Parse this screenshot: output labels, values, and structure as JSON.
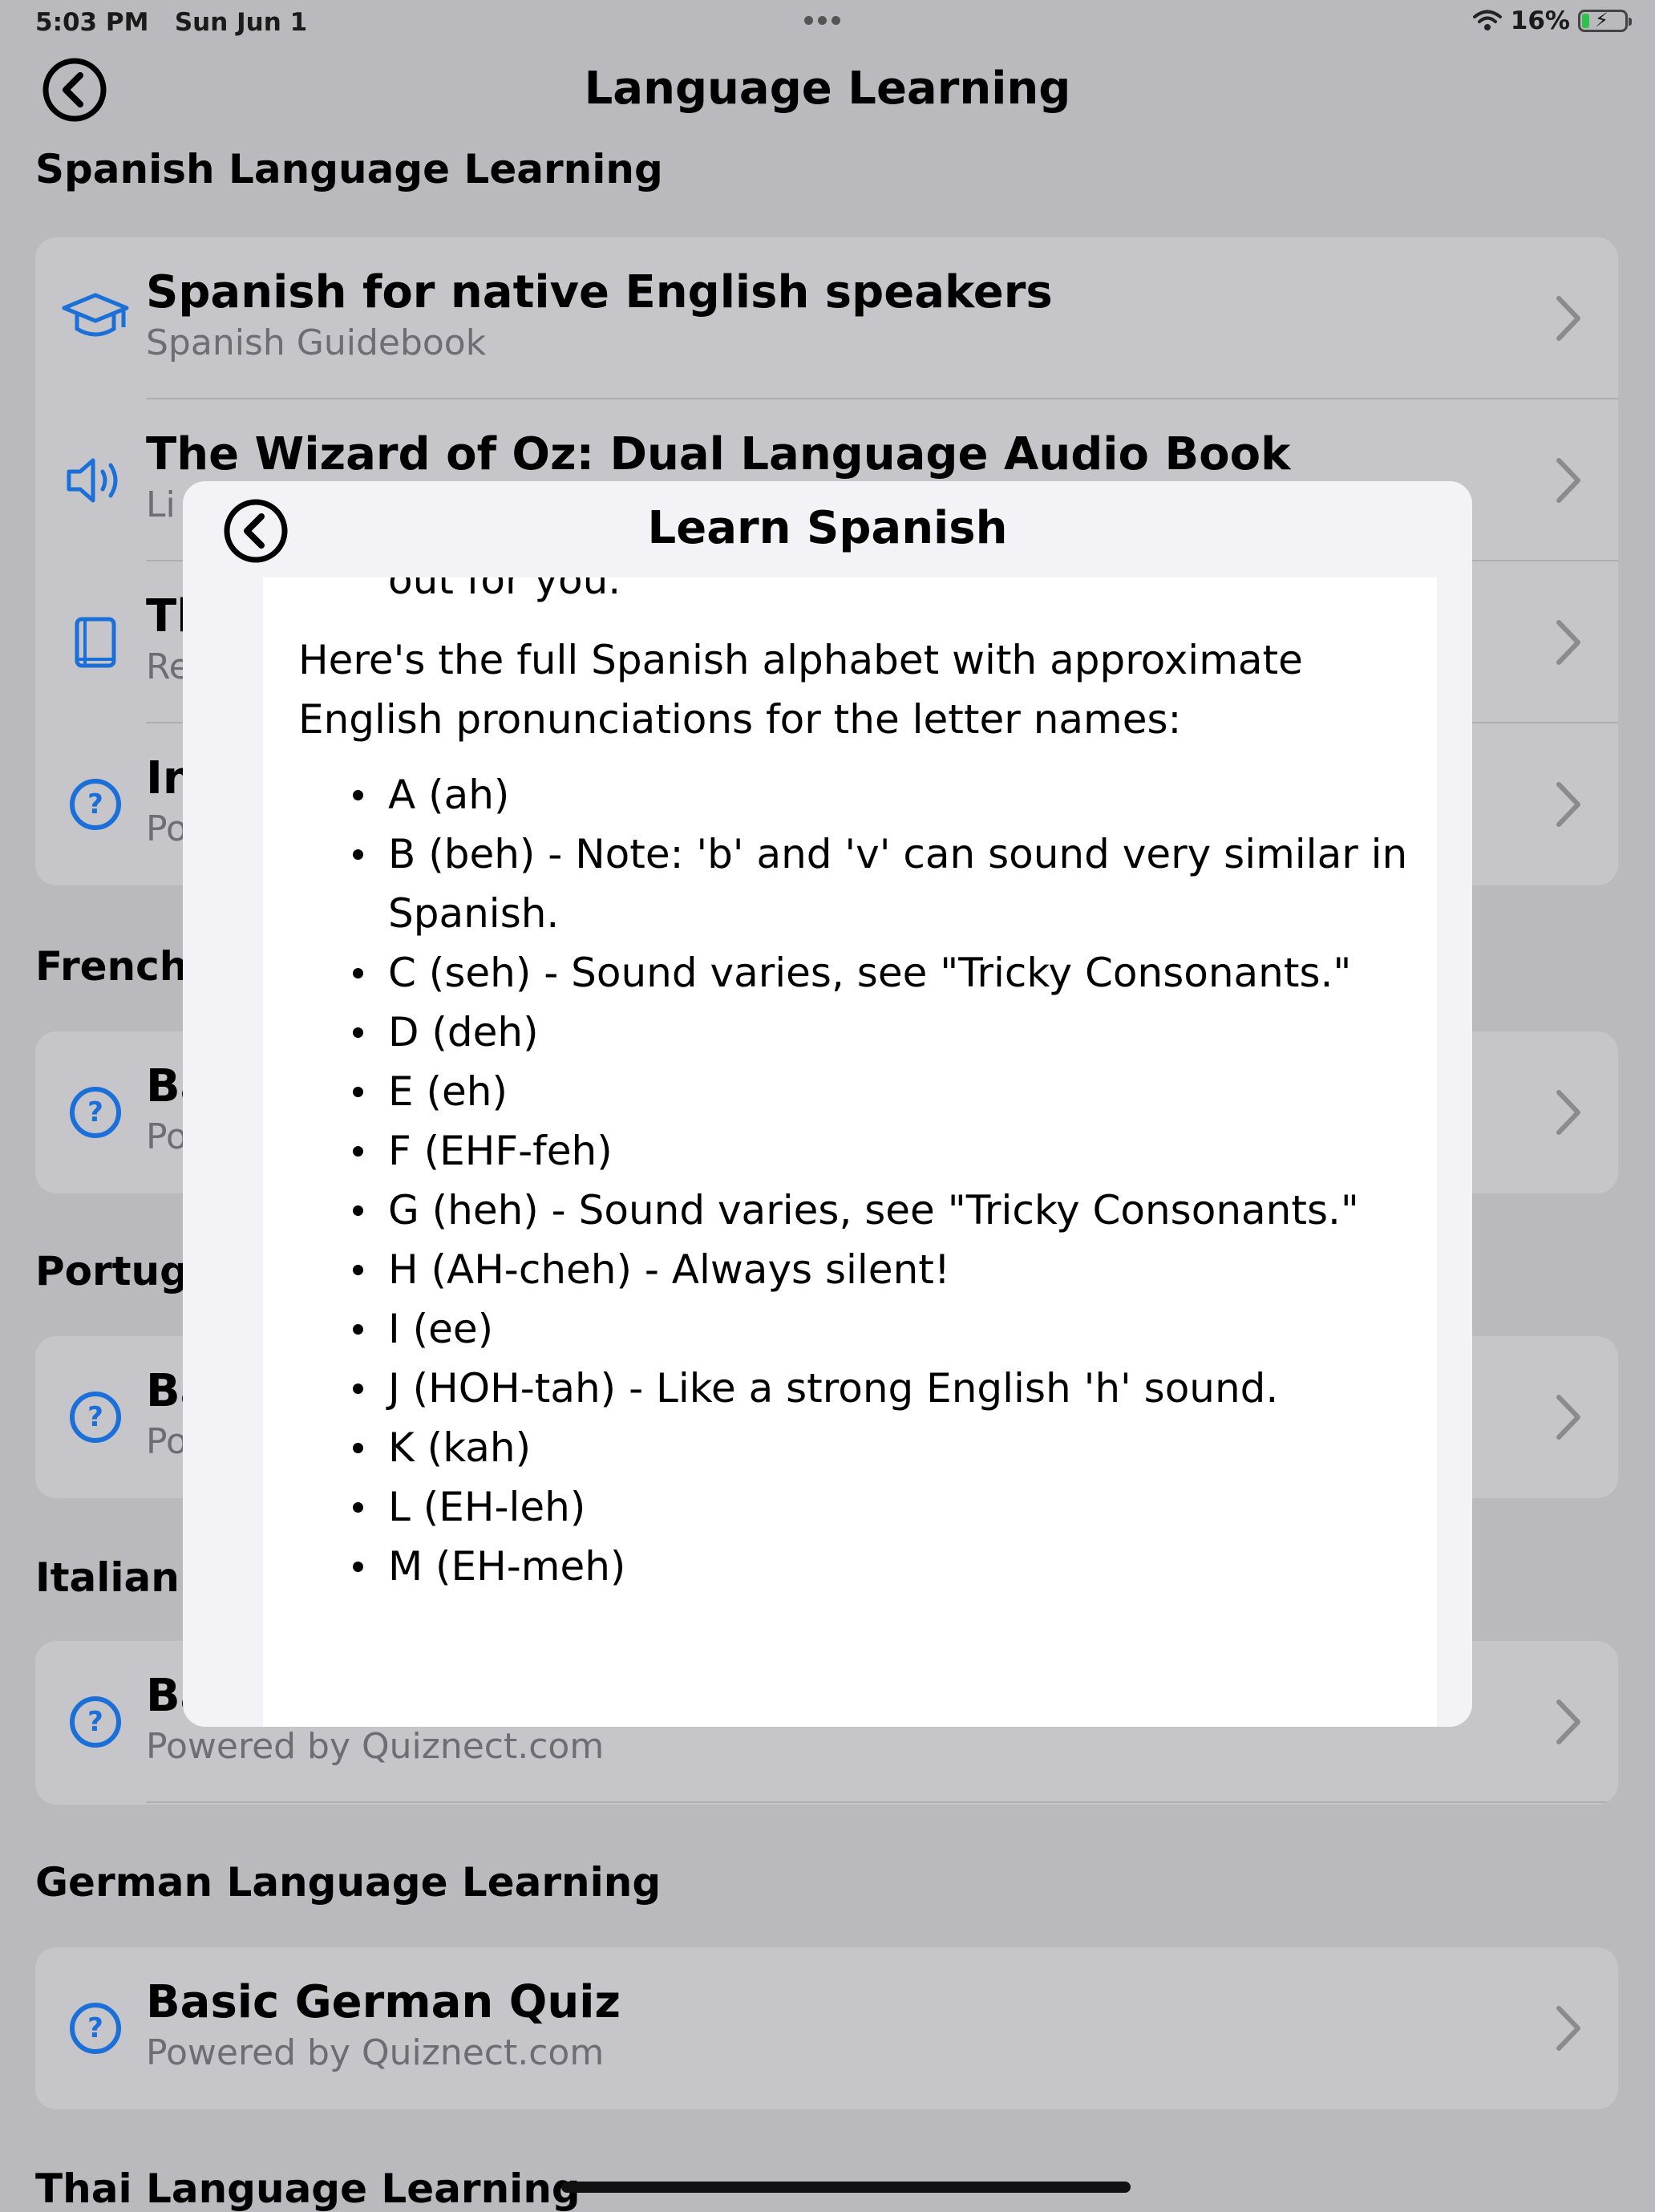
{
  "status_bar": {
    "time": "5:03 PM",
    "date": "Sun Jun 1",
    "battery": "16%",
    "battery_level": 0.16
  },
  "nav": {
    "title": "Language Learning",
    "back_icon": "back-circle-icon"
  },
  "sections": [
    {
      "header": "Spanish Language Learning",
      "rows": [
        {
          "icon": "graduation-cap-icon",
          "title": "Spanish for native English speakers",
          "subtitle": "Spanish Guidebook"
        },
        {
          "icon": "speaker-icon",
          "title": "The Wizard of Oz: Dual Language Audio Book",
          "subtitle": "Li"
        },
        {
          "icon": "book-icon",
          "title": "Th",
          "subtitle": "Re"
        },
        {
          "icon": "question-circle-icon",
          "title": "In",
          "subtitle": "Po"
        }
      ]
    },
    {
      "header": "French",
      "rows": [
        {
          "icon": "question-circle-icon",
          "title": "Ba",
          "subtitle": "Po"
        }
      ]
    },
    {
      "header": "Portug",
      "rows": [
        {
          "icon": "question-circle-icon",
          "title": "Ba",
          "subtitle": "Po"
        }
      ]
    },
    {
      "header": "Italian",
      "rows": [
        {
          "icon": "question-circle-icon",
          "title": "Ba",
          "subtitle": "Powered by Quiznect.com"
        }
      ]
    },
    {
      "header": "German Language Learning",
      "rows": [
        {
          "icon": "question-circle-icon",
          "title": "Basic German Quiz",
          "subtitle": "Powered by Quiznect.com"
        }
      ]
    },
    {
      "header": "Thai Language Learning",
      "rows": []
    }
  ],
  "modal": {
    "title": "Learn Spanish",
    "clipped_text": "out for you.",
    "intro": "Here's the full Spanish alphabet with approximate English pronunciations for the letter names:",
    "alphabet": [
      "A (ah)",
      "B (beh) - Note: 'b' and 'v' can sound very similar in Spanish.",
      "C (seh) - Sound varies, see \"Tricky Consonants.\"",
      "D (deh)",
      "E (eh)",
      "F (EHF-feh)",
      "G (heh) - Sound varies, see \"Tricky Consonants.\"",
      "H (AH-cheh) - Always silent!",
      "I (ee)",
      "J (HOH-tah) - Like a strong English 'h' sound.",
      "K (kah)",
      "L (EH-leh)",
      "M (EH-meh)"
    ]
  },
  "colors": {
    "accent": "#1a6fd8",
    "background": "#b9b9be",
    "card": "#c6c6ca",
    "modal": "#f2f2f7",
    "subtitle": "#6d6d73"
  }
}
